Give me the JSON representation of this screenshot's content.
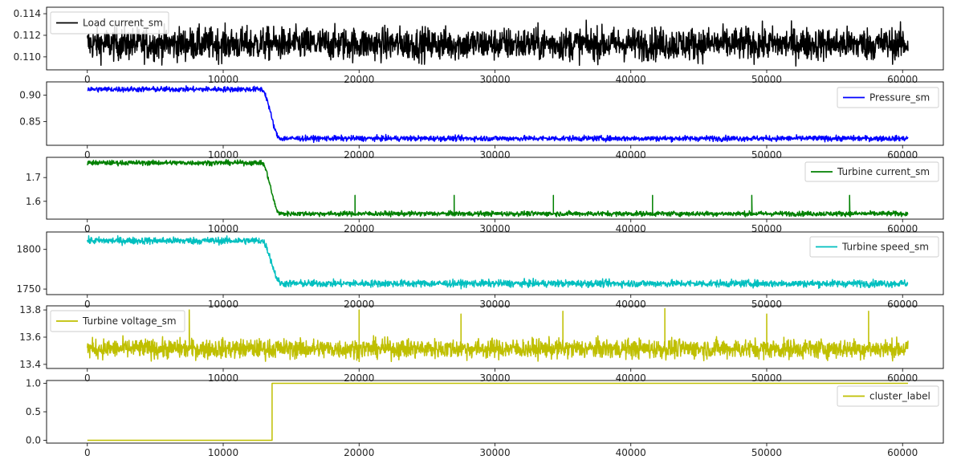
{
  "chart_data": [
    {
      "type": "line",
      "series": [
        {
          "name": "Load current_sm",
          "color": "#000000"
        }
      ],
      "signal": {
        "kind": "noise",
        "base": 0.1112,
        "noise": 0.00075,
        "extra_spikes": []
      },
      "x": {
        "ticks": [
          0,
          10000,
          20000,
          30000,
          40000,
          50000,
          60000
        ],
        "tick_labels": [
          "0",
          "10000",
          "20000",
          "30000",
          "40000",
          "50000",
          "60000"
        ],
        "range": [
          -3000,
          63000
        ],
        "data_range": [
          0,
          60400
        ]
      },
      "y": {
        "ticks": [
          0.11,
          0.112,
          0.114
        ],
        "tick_labels": [
          "0.110",
          "0.112",
          "0.114"
        ],
        "range": [
          0.1088,
          0.1146
        ]
      },
      "legend": "top-left",
      "grid": false
    },
    {
      "type": "line",
      "series": [
        {
          "name": "Pressure_sm",
          "color": "#0000ff"
        }
      ],
      "signal": {
        "kind": "drop",
        "high": 0.911,
        "low": 0.818,
        "drop_start": 12800,
        "drop_end": 14200,
        "noise": 0.0025,
        "spike_x": [],
        "spike_y": null
      },
      "x": {
        "ticks": [
          0,
          10000,
          20000,
          30000,
          40000,
          50000,
          60000
        ],
        "tick_labels": [
          "0",
          "10000",
          "20000",
          "30000",
          "40000",
          "50000",
          "60000"
        ],
        "range": [
          -3000,
          63000
        ],
        "data_range": [
          0,
          60400
        ]
      },
      "y": {
        "ticks": [
          0.85,
          0.9
        ],
        "tick_labels": [
          "0.85",
          "0.90"
        ],
        "range": [
          0.805,
          0.925
        ]
      },
      "legend": "top-right",
      "grid": false
    },
    {
      "type": "line",
      "series": [
        {
          "name": "Turbine current_sm",
          "color": "#008000"
        }
      ],
      "signal": {
        "kind": "drop",
        "high": 1.762,
        "low": 1.548,
        "drop_start": 12800,
        "drop_end": 14200,
        "noise": 0.005,
        "spike_x": [
          19700,
          27000,
          34300,
          41600,
          48900,
          56100
        ],
        "spike_y": 1.625
      },
      "x": {
        "ticks": [
          0,
          10000,
          20000,
          30000,
          40000,
          50000,
          60000
        ],
        "tick_labels": [
          "0",
          "10000",
          "20000",
          "30000",
          "40000",
          "50000",
          "60000"
        ],
        "range": [
          -3000,
          63000
        ],
        "data_range": [
          0,
          60400
        ]
      },
      "y": {
        "ticks": [
          1.6,
          1.7
        ],
        "tick_labels": [
          "1.6",
          "1.7"
        ],
        "range": [
          1.525,
          1.785
        ]
      },
      "legend": "top-right",
      "grid": false
    },
    {
      "type": "line",
      "series": [
        {
          "name": "Turbine speed_sm",
          "color": "#00bfbf"
        }
      ],
      "signal": {
        "kind": "drop",
        "high": 1811,
        "low": 1757,
        "drop_start": 12800,
        "drop_end": 14300,
        "noise": 2.2,
        "spike_x": [],
        "spike_y": null
      },
      "x": {
        "ticks": [
          0,
          10000,
          20000,
          30000,
          40000,
          50000,
          60000
        ],
        "tick_labels": [
          "0",
          "10000",
          "20000",
          "30000",
          "40000",
          "50000",
          "60000"
        ],
        "range": [
          -3000,
          63000
        ],
        "data_range": [
          0,
          60400
        ]
      },
      "y": {
        "ticks": [
          1750,
          1800
        ],
        "tick_labels": [
          "1750",
          "1800"
        ],
        "range": [
          1743,
          1822
        ]
      },
      "legend": "top-right",
      "grid": false
    },
    {
      "type": "line",
      "series": [
        {
          "name": "Turbine voltage_sm",
          "color": "#bfbf00"
        }
      ],
      "signal": {
        "kind": "noise",
        "base": 13.515,
        "noise": 0.035,
        "extra_spikes": [
          {
            "x": 7500,
            "y": 13.8
          },
          {
            "x": 20000,
            "y": 13.8
          },
          {
            "x": 27500,
            "y": 13.77
          },
          {
            "x": 35000,
            "y": 13.79
          },
          {
            "x": 42500,
            "y": 13.81
          },
          {
            "x": 50000,
            "y": 13.77
          },
          {
            "x": 57500,
            "y": 13.79
          }
        ]
      },
      "x": {
        "ticks": [
          0,
          10000,
          20000,
          30000,
          40000,
          50000,
          60000
        ],
        "tick_labels": [
          "0",
          "10000",
          "20000",
          "30000",
          "40000",
          "50000",
          "60000"
        ],
        "range": [
          -3000,
          63000
        ],
        "data_range": [
          0,
          60400
        ]
      },
      "y": {
        "ticks": [
          13.4,
          13.6,
          13.8
        ],
        "tick_labels": [
          "13.4",
          "13.6",
          "13.8"
        ],
        "range": [
          13.37,
          13.83
        ]
      },
      "legend": "top-left",
      "grid": false
    },
    {
      "type": "line",
      "series": [
        {
          "name": "cluster_label",
          "color": "#bfbf00",
          "x": [
            0,
            13600,
            13600,
            60400
          ],
          "y": [
            0,
            0,
            1,
            1
          ]
        }
      ],
      "x": {
        "ticks": [
          0,
          10000,
          20000,
          30000,
          40000,
          50000,
          60000
        ],
        "tick_labels": [
          "0",
          "10000",
          "20000",
          "30000",
          "40000",
          "50000",
          "60000"
        ],
        "range": [
          -3000,
          63000
        ],
        "data_range": [
          0,
          60400
        ]
      },
      "y": {
        "ticks": [
          0.0,
          0.5,
          1.0
        ],
        "tick_labels": [
          "0.0",
          "0.5",
          "1.0"
        ],
        "range": [
          -0.05,
          1.05
        ]
      },
      "legend": "top-right",
      "grid": false
    }
  ]
}
